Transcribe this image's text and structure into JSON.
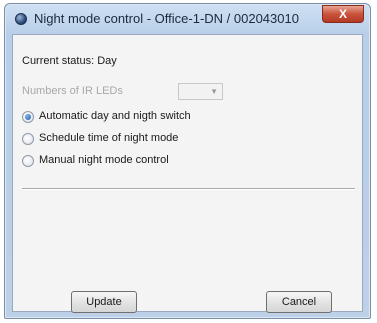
{
  "window": {
    "title": "Night mode control - Office-1-DN / 002043010",
    "close_label": "X"
  },
  "status": {
    "text": "Current status: Day"
  },
  "ir_leds": {
    "label": "Numbers of IR LEDs",
    "value": "",
    "enabled": false
  },
  "mode_options": [
    {
      "label": "Automatic day and nigth switch",
      "checked": true
    },
    {
      "label": "Schedule time of night mode",
      "checked": false
    },
    {
      "label": "Manual night mode control",
      "checked": false
    }
  ],
  "buttons": {
    "update_label": "Update",
    "cancel_label": "Cancel"
  },
  "colors": {
    "title_bar": "#bcd0e8",
    "close_button": "#c9523a",
    "client_background": "#f4f4f4",
    "radio_checked": "#1f5fae"
  }
}
